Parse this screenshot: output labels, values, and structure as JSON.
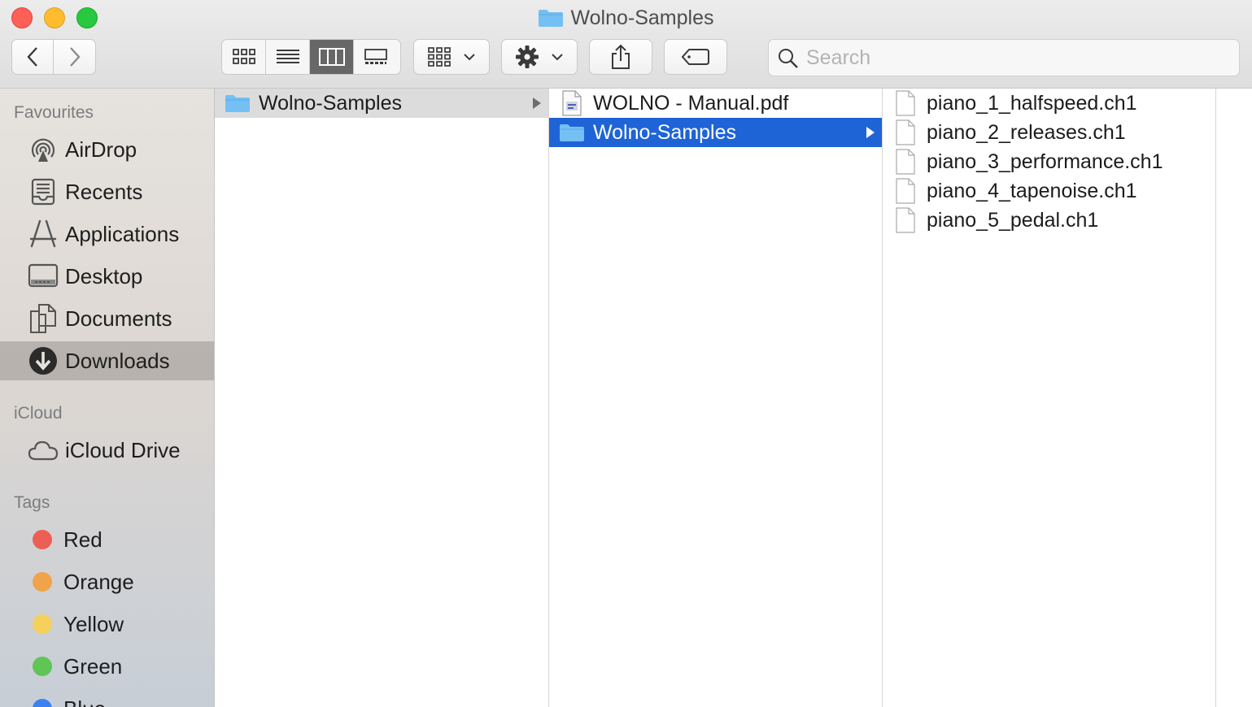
{
  "window": {
    "title": "Wolno-Samples"
  },
  "toolbar": {
    "back_icon": "chevron-left-icon",
    "forward_icon": "chevron-right-icon",
    "view_modes": [
      "icon-view-icon",
      "list-view-icon",
      "column-view-icon",
      "gallery-view-icon"
    ],
    "active_view": "column-view-icon",
    "group_icon": "group-grid-icon",
    "action_icon": "gear-icon",
    "share_icon": "share-icon",
    "tag_icon": "tag-icon",
    "search_placeholder": "Search"
  },
  "sidebar": {
    "favourites_header": "Favourites",
    "favourites": [
      {
        "label": "AirDrop",
        "icon": "airdrop-icon"
      },
      {
        "label": "Recents",
        "icon": "recents-icon"
      },
      {
        "label": "Applications",
        "icon": "applications-icon"
      },
      {
        "label": "Desktop",
        "icon": "desktop-icon"
      },
      {
        "label": "Documents",
        "icon": "documents-icon"
      },
      {
        "label": "Downloads",
        "icon": "downloads-icon",
        "selected": true
      }
    ],
    "icloud_header": "iCloud",
    "icloud": [
      {
        "label": "iCloud Drive",
        "icon": "cloud-icon"
      }
    ],
    "tags_header": "Tags",
    "tags": [
      {
        "label": "Red",
        "color": "#ec5f55"
      },
      {
        "label": "Orange",
        "color": "#f0a34a"
      },
      {
        "label": "Yellow",
        "color": "#f5d05a"
      },
      {
        "label": "Green",
        "color": "#5fc555"
      },
      {
        "label": "Blue",
        "color": "#3b82f0"
      }
    ]
  },
  "columns": {
    "col1": [
      {
        "name": "Wolno-Samples",
        "kind": "folder",
        "selected": "gray"
      }
    ],
    "col2": [
      {
        "name": "WOLNO - Manual.pdf",
        "kind": "pdf"
      },
      {
        "name": "Wolno-Samples",
        "kind": "folder",
        "selected": "blue"
      }
    ],
    "col3": [
      {
        "name": "piano_1_halfspeed.ch1",
        "kind": "file"
      },
      {
        "name": "piano_2_releases.ch1",
        "kind": "file"
      },
      {
        "name": "piano_3_performance.ch1",
        "kind": "file"
      },
      {
        "name": "piano_4_tapenoise.ch1",
        "kind": "file"
      },
      {
        "name": "piano_5_pedal.ch1",
        "kind": "file"
      }
    ]
  },
  "colors": {
    "selection_blue": "#1f64d6",
    "folder_blue": "#74c0f4"
  }
}
